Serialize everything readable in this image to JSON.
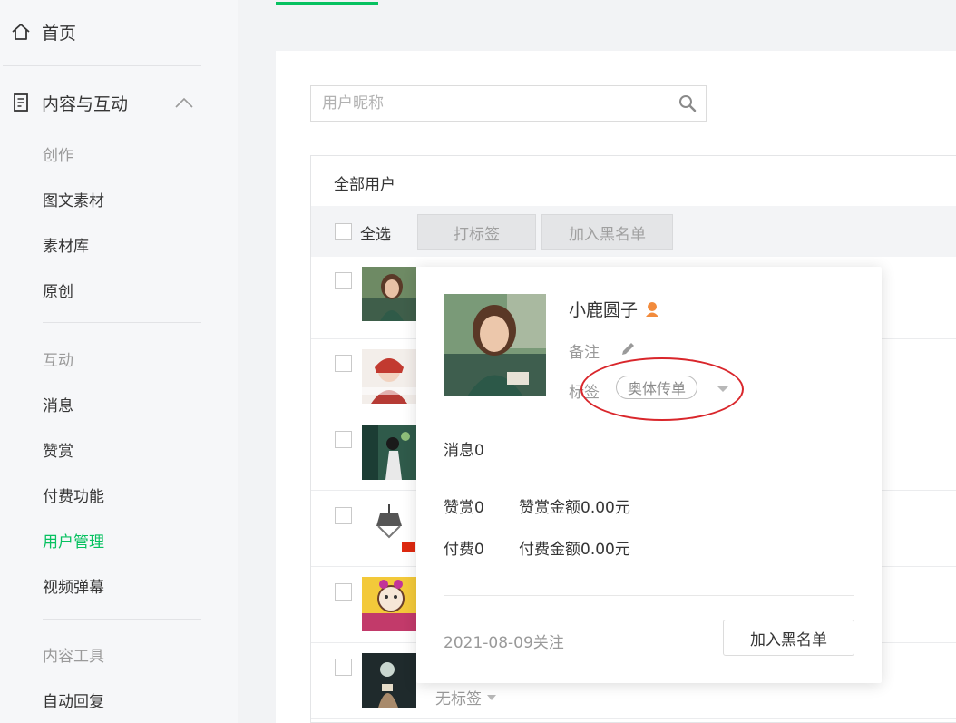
{
  "sidebar": {
    "home": "首页",
    "section": "内容与互动",
    "groups": [
      {
        "label": "创作",
        "items": [
          "图文素材",
          "素材库",
          "原创"
        ]
      },
      {
        "label": "互动",
        "items": [
          "消息",
          "赞赏",
          "付费功能",
          "用户管理",
          "视频弹幕"
        ]
      },
      {
        "label": "内容工具",
        "items": [
          "自动回复"
        ]
      }
    ],
    "active_item": "用户管理"
  },
  "search": {
    "placeholder": "用户昵称"
  },
  "users": {
    "title": "全部用户",
    "select_all": "全选",
    "tag_button": "打标签",
    "blacklist_button": "加入黑名单",
    "row_no_tag": "无标签"
  },
  "card": {
    "nickname": "小鹿圆子",
    "remark_label": "备注",
    "tag_label": "标签",
    "tag_value": "奥体传单",
    "messages": "消息0",
    "reward_count": "赞赏0",
    "reward_amount": "赞赏金额0.00元",
    "pay_count": "付费0",
    "pay_amount": "付费金额0.00元",
    "follow_date": "2021-08-09关注",
    "blacklist_button": "加入黑名单"
  },
  "colors": {
    "accent": "#07c160",
    "annotation": "#d9262b"
  }
}
